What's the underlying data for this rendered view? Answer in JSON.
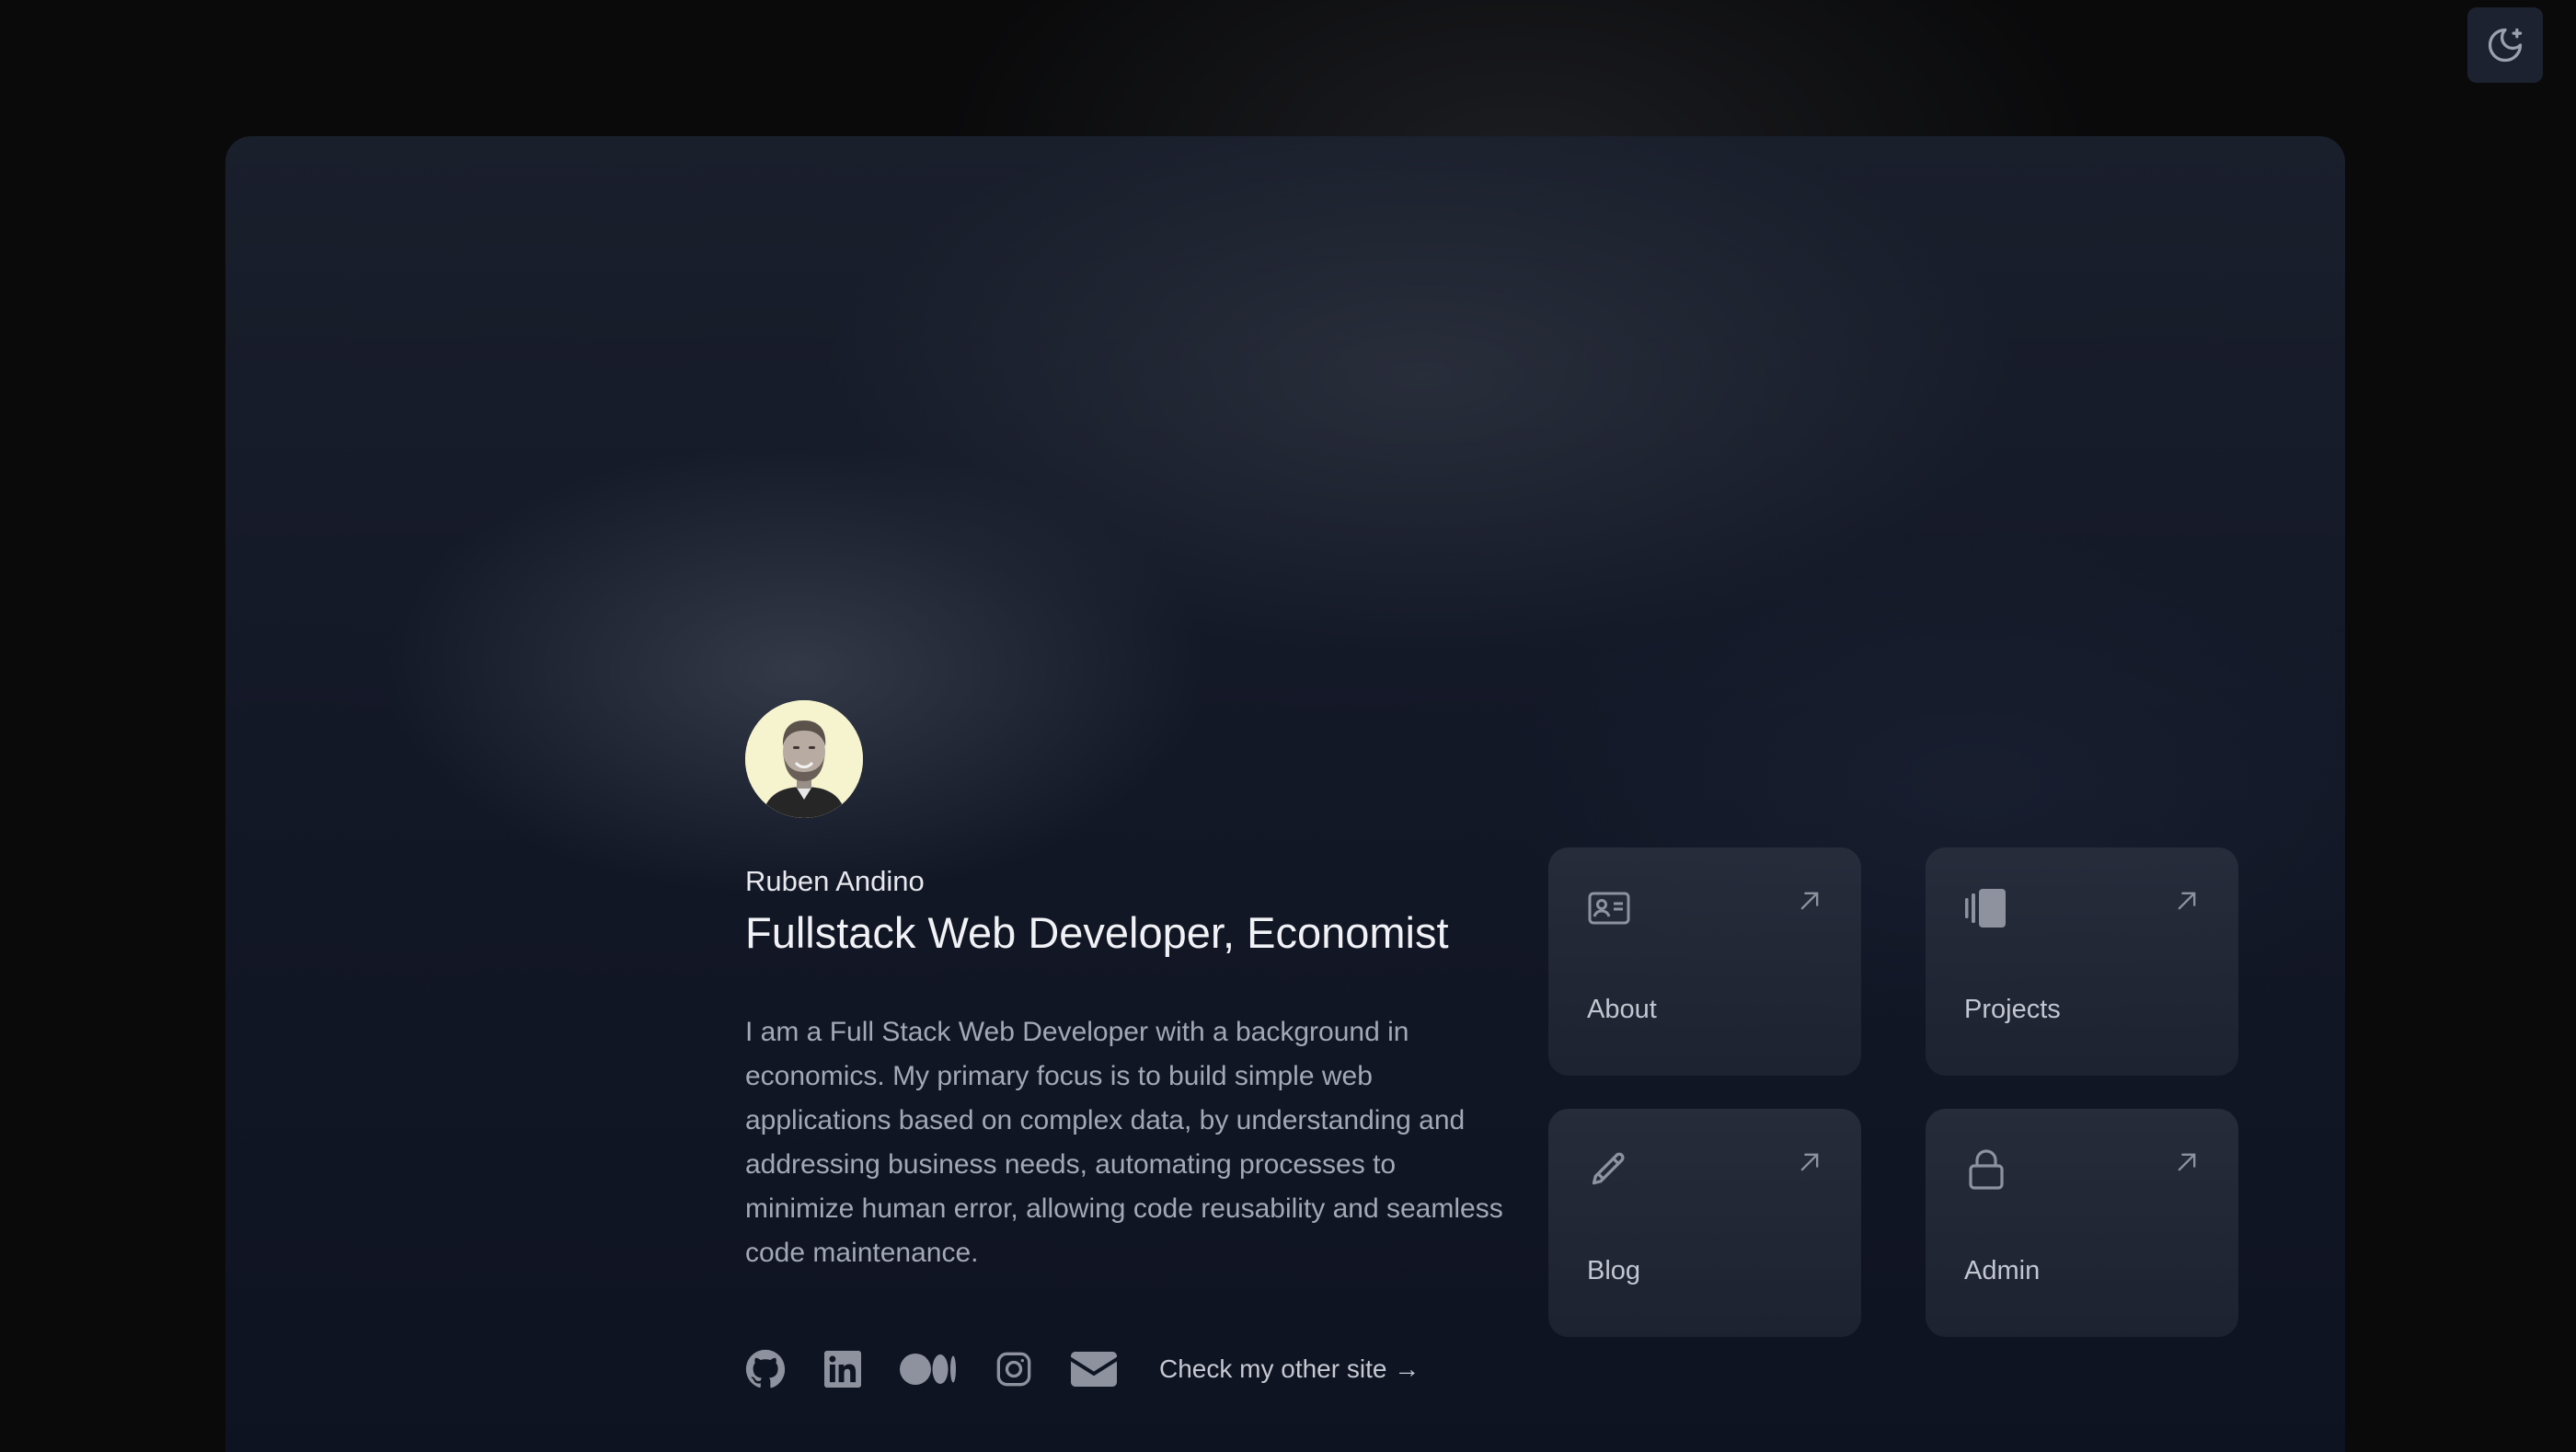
{
  "profile": {
    "name": "Ruben Andino",
    "title": "Fullstack Web Developer, Economist",
    "bio": "I am a Full Stack Web Developer with a background in economics. My primary focus is to build simple web applications based on complex data, by understanding and addressing business needs, automating processes to minimize human error, allowing code reusability and seamless code maintenance."
  },
  "socials": [
    {
      "icon": "github-icon"
    },
    {
      "icon": "linkedin-icon"
    },
    {
      "icon": "medium-icon"
    },
    {
      "icon": "instagram-icon"
    },
    {
      "icon": "mail-icon"
    }
  ],
  "other_site": {
    "label": "Check my other site →"
  },
  "tiles": [
    {
      "label": "About",
      "icon": "id-card-icon"
    },
    {
      "label": "Projects",
      "icon": "stacked-cards-icon"
    },
    {
      "label": "Blog",
      "icon": "pencil-icon"
    },
    {
      "label": "Admin",
      "icon": "lock-icon"
    }
  ],
  "theme_toggle": {
    "icon": "moon-stars-icon"
  },
  "colors": {
    "background": "#0a0a0b",
    "card": "#131827",
    "tile": "#222836",
    "text_primary": "#f1f2f6",
    "text_secondary": "#a3a8b5",
    "icon": "#8d929e"
  }
}
